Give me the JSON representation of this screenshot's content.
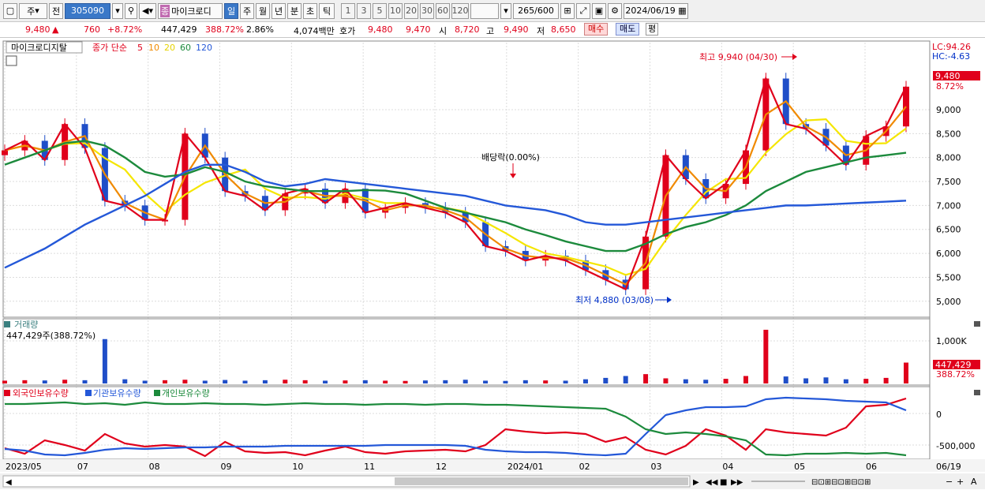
{
  "toolbar": {
    "market": "주",
    "mode": "전",
    "code": "305090",
    "name": "마이크로디",
    "periods": [
      "일",
      "주",
      "월",
      "년",
      "분",
      "초",
      "틱"
    ],
    "nums": [
      "1",
      "3",
      "5",
      "10",
      "20",
      "30",
      "60",
      "120"
    ],
    "count": "265",
    "total": "/600",
    "date": "2024/06/19"
  },
  "quote": {
    "price": "9,480",
    "arrow": "▲",
    "change": "760",
    "pct": "+8.72%",
    "volume": "447,429",
    "vol_ratio": "388.72%",
    "turnover": "2.86%",
    "amount": "4,074백만",
    "bid_label": "호가",
    "ask": "9,480",
    "bid": "9,470",
    "open_label": "시",
    "open": "8,720",
    "high_label": "고",
    "high": "9,490",
    "low_label": "저",
    "low": "8,650",
    "buy": "매수",
    "sell": "매도",
    "eval": "평"
  },
  "main_panel": {
    "title": "마이크로디지탈",
    "ma_label": "종가 단순",
    "ma": [
      "5",
      "10",
      "20",
      "60",
      "120"
    ],
    "lc": "LC:94.26",
    "hc": "HC:-4.63",
    "high_note": "최고 9,940 (04/30)",
    "low_note": "최저 4,880 (03/08)",
    "div_note": "배당락(0.00%)",
    "price_tag": "9,480",
    "pct_tag": "8.72%"
  },
  "volume_panel": {
    "title": "거래량",
    "value": "447,429주(388.72%)",
    "tag": "447,429",
    "tag2": "388.72%",
    "tick": "1,000K"
  },
  "holding_panel": {
    "s1": "외국인보유수량",
    "s2": "기관보유수량",
    "s3": "개인보유수량",
    "ticks": [
      "0",
      "-500,000"
    ]
  },
  "x_axis": {
    "labels": [
      "2023/05",
      "07",
      "08",
      "09",
      "10",
      "11",
      "12",
      "2024/01",
      "02",
      "03",
      "04",
      "05",
      "06"
    ],
    "end": "06/19"
  },
  "colors": {
    "up": "#e0001b",
    "down": "#1f4ec8",
    "ma5": "#e0001b",
    "ma10": "#f08a00",
    "ma20": "#f5e600",
    "ma60": "#1c8a3c",
    "ma120": "#2458d8"
  },
  "chart_data": {
    "type": "line",
    "title": "마이크로디지탈",
    "ylim": [
      4700,
      10400
    ],
    "y_ticks": [
      5000,
      5500,
      6000,
      6500,
      7000,
      7500,
      8000,
      8500,
      9000
    ],
    "x": [
      "2023/05",
      "07",
      "08",
      "09",
      "10",
      "11",
      "12",
      "2024/01",
      "02",
      "03",
      "04",
      "05",
      "06"
    ],
    "series": [
      {
        "name": "종가",
        "values": [
          8150,
          8350,
          7950,
          8700,
          8200,
          7100,
          7000,
          6700,
          6700,
          8500,
          8000,
          7300,
          7200,
          6900,
          7250,
          7350,
          7050,
          7350,
          6850,
          6950,
          7050,
          6950,
          6850,
          6650,
          6150,
          6050,
          5850,
          5950,
          5850,
          5650,
          5450,
          5250,
          6350,
          8050,
          7550,
          7150,
          7450,
          8150,
          9650,
          8700,
          8600,
          8250,
          7850,
          8450,
          8650,
          9480
        ]
      },
      {
        "name": "60",
        "values": [
          7850,
          8000,
          8150,
          8300,
          8350,
          8250,
          8000,
          7700,
          7600,
          7650,
          7800,
          7700,
          7500,
          7400,
          7350,
          7300,
          7300,
          7300,
          7320,
          7310,
          7250,
          7100,
          6950,
          6850,
          6750,
          6650,
          6500,
          6380,
          6250,
          6150,
          6050,
          6050,
          6200,
          6400,
          6550,
          6650,
          6800,
          7000,
          7300,
          7500,
          7700,
          7800,
          7900,
          8000,
          8050,
          8100
        ]
      },
      {
        "name": "120",
        "values": [
          5700,
          5900,
          6100,
          6350,
          6600,
          6800,
          7000,
          7200,
          7450,
          7700,
          7850,
          7850,
          7700,
          7500,
          7400,
          7450,
          7550,
          7500,
          7450,
          7400,
          7350,
          7300,
          7250,
          7200,
          7100,
          7000,
          6950,
          6900,
          6800,
          6650,
          6600,
          6600,
          6650,
          6700,
          6750,
          6800,
          6850,
          6900,
          6950,
          7000,
          7000,
          7020,
          7040,
          7060,
          7080,
          7100
        ]
      }
    ],
    "volume_tick": 1000,
    "volume_k": [
      60,
      70,
      65,
      80,
      70,
      950,
      90,
      60,
      70,
      80,
      60,
      75,
      60,
      70,
      80,
      70,
      60,
      65,
      70,
      60,
      55,
      65,
      70,
      80,
      60,
      55,
      70,
      65,
      60,
      90,
      120,
      160,
      200,
      110,
      90,
      80,
      100,
      160,
      1150,
      150,
      110,
      130,
      90,
      100,
      120,
      447
    ]
  }
}
